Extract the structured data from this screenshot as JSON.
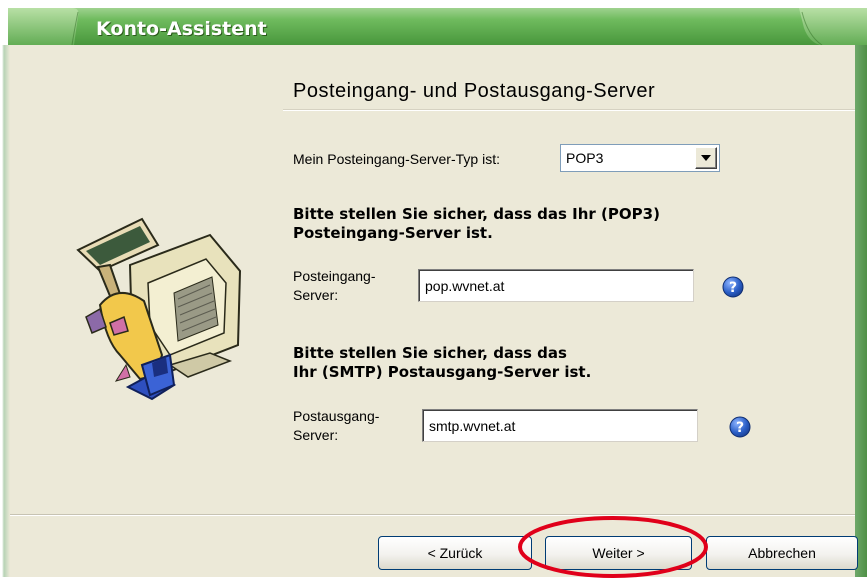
{
  "window": {
    "title": "Konto-Assistent"
  },
  "page": {
    "heading": "Posteingang- und Postausgang-Server"
  },
  "server_type": {
    "label": "Mein Posteingang-Server-Typ ist:",
    "selected": "POP3"
  },
  "incoming": {
    "note_line1": "Bitte stellen Sie sicher, dass das Ihr (POP3)",
    "note_line2": "Posteingang-Server ist.",
    "label_line1": "Posteingang-",
    "label_line2": "Server:",
    "value": "pop.wvnet.at"
  },
  "outgoing": {
    "note_line1": "Bitte stellen Sie sicher, dass das",
    "note_line2": "Ihr (SMTP) Postausgang-Server ist.",
    "label_line1": "Postausgang-",
    "label_line2": "Server:",
    "value": "smtp.wvnet.at"
  },
  "buttons": {
    "back": "< Zurück",
    "next": "Weiter >",
    "cancel": "Abbrechen"
  },
  "icons": {
    "help": "help-icon",
    "dropdown": "chevron-down-icon",
    "illustration": "mail-computer-illustration"
  },
  "colors": {
    "titlebar": "#6fb864",
    "dialog_bg": "#ece9d8",
    "help_blue": "#2b5fc7",
    "highlight_circle": "#e0001a"
  }
}
